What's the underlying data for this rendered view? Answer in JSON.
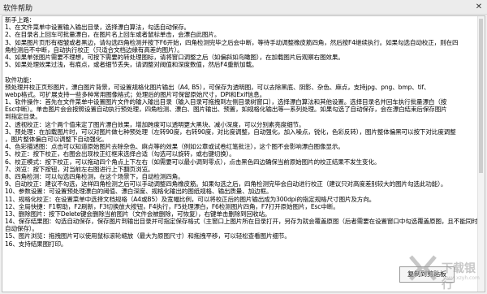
{
  "window": {
    "title": "软件帮助",
    "close_glyph": "✕"
  },
  "help": {
    "lines": [
      "新手上路：",
      "1、在文件菜单中设置输入输出目录，选择漂白算法，勾选自动保存。",
      "2、在目录名上回车可批量漂白，在图片名上回车或者鼠标单击，会漂白此图片。",
      "3、如果图片页形有褶皱或者黑边，请勾选四角检测并按下F6开始，四角检测完毕之后会中断，等待手动调整橡皮筋四角，然后按F4继续执行。如果勾选自动校正，则在四",
      "角检测后不中断，自动执行校正（只适合文档边缘有高差的图片）。",
      "4、如果单张图片需要不理想，可按下需要的转处理图标，请将窗口调整之后（如偏斜如鸟瞰图），在加载图片后观察右图效果。",
      "5、如果处理效果过浅，有痕点，或者细节丢失，请调整对阈值和深度数值，然后F4重新加载。",
      "",
      "软件功能：",
      "    预处理并校正页形图片，漂白图片背景，可设置规格化图片输出（A4, B5），可保存为透明图，可以去除黑底、阴影、杂色、麻点，支持jpg、png、bmp、tif、",
      "webp格式。可扩展支持一些多种常用图像格式；处理后的图片可保留原始尺寸，DPI和Exif信息。",
      "1、软件操作：首先在文件菜单中设置图片文件的输入输出目录（输入目录可拖拽到左侧目录树窗口），选择漂白算法和其他设置。选择目录名并回车执行批量漂白（按",
      "Esc中断）。单击图片会会按照设置自动执行预处理，四角检测、漂白、图片输出、预置，如规格化输出等一系列处理。如果勾选了自动保存，会在漂白结束后保存图片",
      "到指定目录。",
      "2、透视校正：这个两个值来定了图片漂白效果，增加跨度可以透明更大黑块、减小深度，可以分别素亮度细节。",
      "3、预处理：在加载图片时，可以对图片做七种预处理（左转90度，右转90度，对比度调整，自动强化，加入噪点，锐化，色彩反转），图片整体偏黑可以按下对比度调整",
      "，图片整体偏白可以调整下自动强化。",
      "4、色彩描述图：点击可以知道原始图片去除杂色、麻点等的效果（例如公章或试卷红笔批注），这个图不会影响漂白图像显示。",
      "5、校正：按下校正，右图会出现校正红框来选择合适（勾选可以旋转，或右键切换）。",
      "6、校正模式：按下校正，可以拖动四个角点上下左右（如需要可以最小调到零点），点击黑色四边确保当前原始图片的校正结果不发生变化。",
      "7、浏览：按下按钮，对当前左右图进行上下翻页浏览。",
      "8、四角检测：可以勾选四角检测，在这个场景下，自动检测四角。",
      "9、自动校正：建议不勾选，这样四角检测之后可以手动调整四角橡皮筋。如果勾选之后，四角检测完毕会自动进行校正（建议只对高度差别较大的图片勾选此功能）。",
      "10、参数设置：可设置预处理漂白的阈值、漂白深度、规格化输出的图纸规格、输出质量、加边框。",
      "11、规格化校正：在设置菜单中选择文档规格（A4或B5）及宽幅比例，可以将校正后的图片输出成为300dpi的指定规格尺寸图片及方向。",
      "12、全局快捷：F1帮助，F2刷新，F3切换放大按钮，F4执行，F5处理漂白，F6检测图片四角，F7打开原始图片，Esc中断。",
      "13、删除图片：按下Delete键会删除当前图片（文件会被删除，可恢复），右键单击删除到回收站。",
      "14、保存结果图：勾选自动保存，保存图片到输出目录并可指定保存格式（主窗口上图片所在目录打开，另存为就会覆盖原图（后者需要在设置窗口中勾选覆盖原图，且不能同时勾选",
      "自动保存）。",
      "15、图片浏览：拖拽图片可以使用鼠标滚轮缩放（最大为原图尺寸）和拖拽平移，可以轻松查看图片细节。",
      "16、支持结果图打印。"
    ]
  },
  "buttons": {
    "copy_label": "复制到剪贴板"
  },
  "watermark": {
    "brand": "下载银行",
    "sub": "www.xzyh.com"
  }
}
